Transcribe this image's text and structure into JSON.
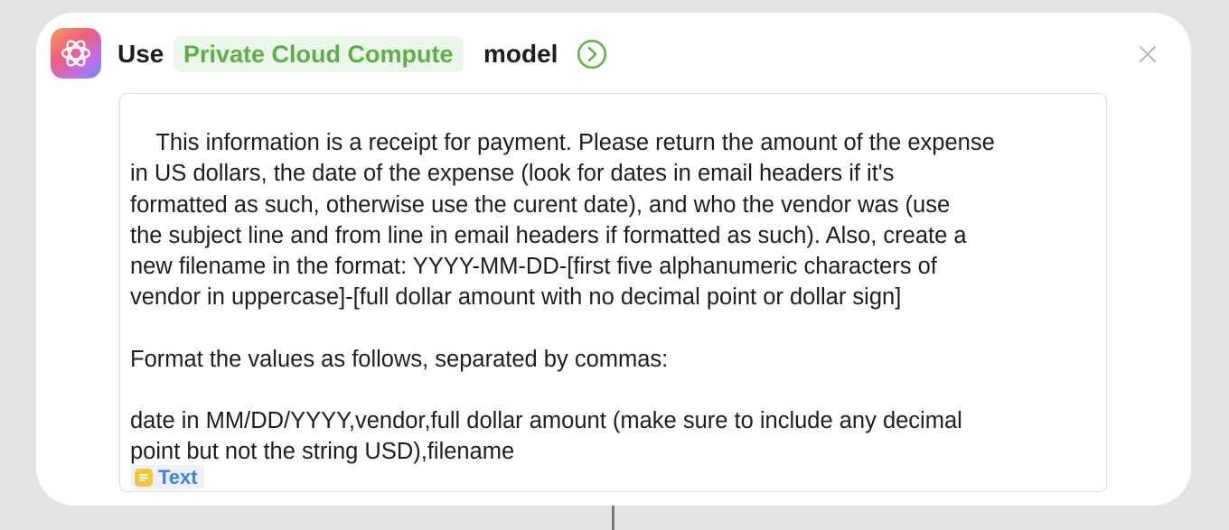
{
  "action": {
    "use_label": "Use",
    "model_name": "Private Cloud Compute",
    "model_label": "model",
    "app_icon": "apple-intelligence-icon",
    "expand_icon": "chevron-right-circle-icon",
    "close_icon": "close-icon"
  },
  "prompt": {
    "lines": [
      "This information is a receipt for payment. Please return the amount of the expense",
      "in US dollars, the date of the expense (look for dates in email headers if it's",
      "formatted as such, otherwise use the curent date), and who the vendor was (use",
      "the subject line and from line in email headers if formatted as such). Also, create a",
      "new filename in the format: YYYY-MM-DD-[first five alphanumeric characters of",
      "vendor in uppercase]-[full dollar amount with no decimal point or dollar sign]",
      "",
      "Format the values as follows, separated by commas:",
      "",
      "date in MM/DD/YYYY,vendor,full dollar amount (make sure to include any decimal",
      "point but not the string USD),filename"
    ],
    "variable_token": {
      "label": "Text",
      "icon": "text-document-icon"
    }
  },
  "colors": {
    "model_pill_bg": "#edf6ea",
    "model_pill_text": "#5cae48",
    "token_bg": "#eef3fb",
    "token_text": "#3f84d8",
    "token_icon": "#f7c442"
  }
}
